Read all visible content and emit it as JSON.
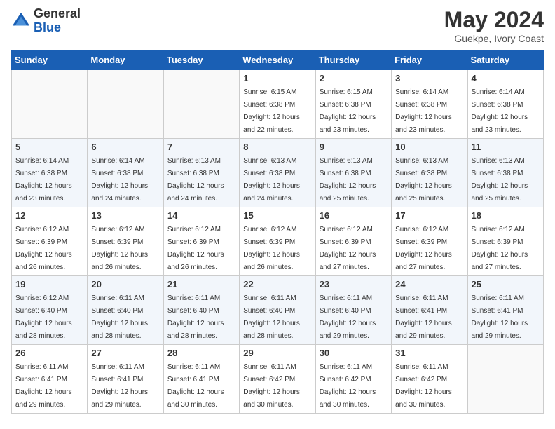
{
  "logo": {
    "general": "General",
    "blue": "Blue"
  },
  "header": {
    "month_year": "May 2024",
    "location": "Guekpe, Ivory Coast"
  },
  "days_of_week": [
    "Sunday",
    "Monday",
    "Tuesday",
    "Wednesday",
    "Thursday",
    "Friday",
    "Saturday"
  ],
  "weeks": [
    [
      {
        "num": "",
        "sunrise": "",
        "sunset": "",
        "daylight": "",
        "empty": true
      },
      {
        "num": "",
        "sunrise": "",
        "sunset": "",
        "daylight": "",
        "empty": true
      },
      {
        "num": "",
        "sunrise": "",
        "sunset": "",
        "daylight": "",
        "empty": true
      },
      {
        "num": "1",
        "sunrise": "Sunrise: 6:15 AM",
        "sunset": "Sunset: 6:38 PM",
        "daylight": "Daylight: 12 hours and 22 minutes."
      },
      {
        "num": "2",
        "sunrise": "Sunrise: 6:15 AM",
        "sunset": "Sunset: 6:38 PM",
        "daylight": "Daylight: 12 hours and 23 minutes."
      },
      {
        "num": "3",
        "sunrise": "Sunrise: 6:14 AM",
        "sunset": "Sunset: 6:38 PM",
        "daylight": "Daylight: 12 hours and 23 minutes."
      },
      {
        "num": "4",
        "sunrise": "Sunrise: 6:14 AM",
        "sunset": "Sunset: 6:38 PM",
        "daylight": "Daylight: 12 hours and 23 minutes."
      }
    ],
    [
      {
        "num": "5",
        "sunrise": "Sunrise: 6:14 AM",
        "sunset": "Sunset: 6:38 PM",
        "daylight": "Daylight: 12 hours and 23 minutes."
      },
      {
        "num": "6",
        "sunrise": "Sunrise: 6:14 AM",
        "sunset": "Sunset: 6:38 PM",
        "daylight": "Daylight: 12 hours and 24 minutes."
      },
      {
        "num": "7",
        "sunrise": "Sunrise: 6:13 AM",
        "sunset": "Sunset: 6:38 PM",
        "daylight": "Daylight: 12 hours and 24 minutes."
      },
      {
        "num": "8",
        "sunrise": "Sunrise: 6:13 AM",
        "sunset": "Sunset: 6:38 PM",
        "daylight": "Daylight: 12 hours and 24 minutes."
      },
      {
        "num": "9",
        "sunrise": "Sunrise: 6:13 AM",
        "sunset": "Sunset: 6:38 PM",
        "daylight": "Daylight: 12 hours and 25 minutes."
      },
      {
        "num": "10",
        "sunrise": "Sunrise: 6:13 AM",
        "sunset": "Sunset: 6:38 PM",
        "daylight": "Daylight: 12 hours and 25 minutes."
      },
      {
        "num": "11",
        "sunrise": "Sunrise: 6:13 AM",
        "sunset": "Sunset: 6:38 PM",
        "daylight": "Daylight: 12 hours and 25 minutes."
      }
    ],
    [
      {
        "num": "12",
        "sunrise": "Sunrise: 6:12 AM",
        "sunset": "Sunset: 6:39 PM",
        "daylight": "Daylight: 12 hours and 26 minutes."
      },
      {
        "num": "13",
        "sunrise": "Sunrise: 6:12 AM",
        "sunset": "Sunset: 6:39 PM",
        "daylight": "Daylight: 12 hours and 26 minutes."
      },
      {
        "num": "14",
        "sunrise": "Sunrise: 6:12 AM",
        "sunset": "Sunset: 6:39 PM",
        "daylight": "Daylight: 12 hours and 26 minutes."
      },
      {
        "num": "15",
        "sunrise": "Sunrise: 6:12 AM",
        "sunset": "Sunset: 6:39 PM",
        "daylight": "Daylight: 12 hours and 26 minutes."
      },
      {
        "num": "16",
        "sunrise": "Sunrise: 6:12 AM",
        "sunset": "Sunset: 6:39 PM",
        "daylight": "Daylight: 12 hours and 27 minutes."
      },
      {
        "num": "17",
        "sunrise": "Sunrise: 6:12 AM",
        "sunset": "Sunset: 6:39 PM",
        "daylight": "Daylight: 12 hours and 27 minutes."
      },
      {
        "num": "18",
        "sunrise": "Sunrise: 6:12 AM",
        "sunset": "Sunset: 6:39 PM",
        "daylight": "Daylight: 12 hours and 27 minutes."
      }
    ],
    [
      {
        "num": "19",
        "sunrise": "Sunrise: 6:12 AM",
        "sunset": "Sunset: 6:40 PM",
        "daylight": "Daylight: 12 hours and 28 minutes."
      },
      {
        "num": "20",
        "sunrise": "Sunrise: 6:11 AM",
        "sunset": "Sunset: 6:40 PM",
        "daylight": "Daylight: 12 hours and 28 minutes."
      },
      {
        "num": "21",
        "sunrise": "Sunrise: 6:11 AM",
        "sunset": "Sunset: 6:40 PM",
        "daylight": "Daylight: 12 hours and 28 minutes."
      },
      {
        "num": "22",
        "sunrise": "Sunrise: 6:11 AM",
        "sunset": "Sunset: 6:40 PM",
        "daylight": "Daylight: 12 hours and 28 minutes."
      },
      {
        "num": "23",
        "sunrise": "Sunrise: 6:11 AM",
        "sunset": "Sunset: 6:40 PM",
        "daylight": "Daylight: 12 hours and 29 minutes."
      },
      {
        "num": "24",
        "sunrise": "Sunrise: 6:11 AM",
        "sunset": "Sunset: 6:41 PM",
        "daylight": "Daylight: 12 hours and 29 minutes."
      },
      {
        "num": "25",
        "sunrise": "Sunrise: 6:11 AM",
        "sunset": "Sunset: 6:41 PM",
        "daylight": "Daylight: 12 hours and 29 minutes."
      }
    ],
    [
      {
        "num": "26",
        "sunrise": "Sunrise: 6:11 AM",
        "sunset": "Sunset: 6:41 PM",
        "daylight": "Daylight: 12 hours and 29 minutes."
      },
      {
        "num": "27",
        "sunrise": "Sunrise: 6:11 AM",
        "sunset": "Sunset: 6:41 PM",
        "daylight": "Daylight: 12 hours and 29 minutes."
      },
      {
        "num": "28",
        "sunrise": "Sunrise: 6:11 AM",
        "sunset": "Sunset: 6:41 PM",
        "daylight": "Daylight: 12 hours and 30 minutes."
      },
      {
        "num": "29",
        "sunrise": "Sunrise: 6:11 AM",
        "sunset": "Sunset: 6:42 PM",
        "daylight": "Daylight: 12 hours and 30 minutes."
      },
      {
        "num": "30",
        "sunrise": "Sunrise: 6:11 AM",
        "sunset": "Sunset: 6:42 PM",
        "daylight": "Daylight: 12 hours and 30 minutes."
      },
      {
        "num": "31",
        "sunrise": "Sunrise: 6:11 AM",
        "sunset": "Sunset: 6:42 PM",
        "daylight": "Daylight: 12 hours and 30 minutes."
      },
      {
        "num": "",
        "sunrise": "",
        "sunset": "",
        "daylight": "",
        "empty": true
      }
    ]
  ]
}
